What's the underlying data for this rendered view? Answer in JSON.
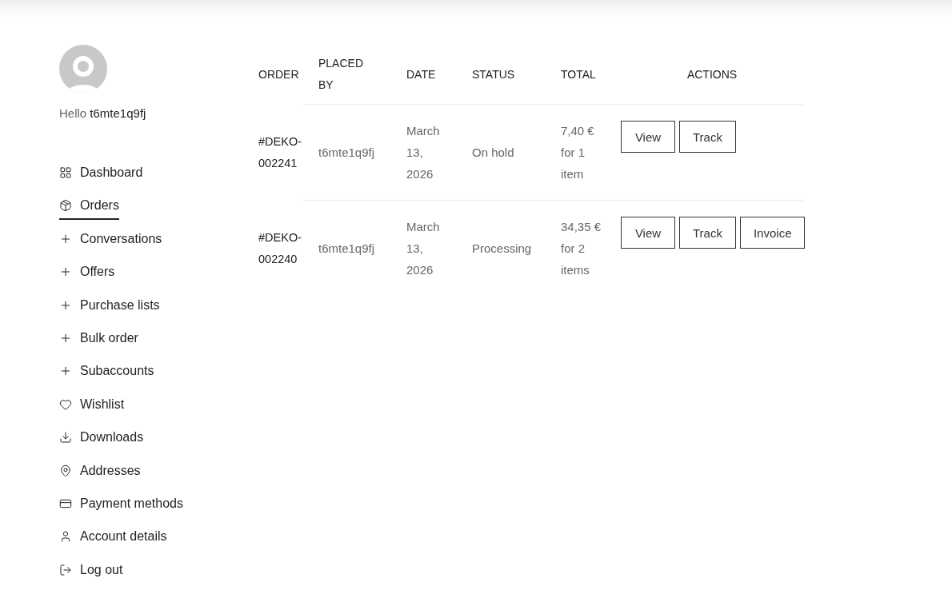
{
  "sidebar": {
    "greeting": "Hello",
    "username": "t6mte1q9fj",
    "items": [
      {
        "label": "Dashboard",
        "selected": false
      },
      {
        "label": "Orders",
        "selected": true
      },
      {
        "label": "Conversations",
        "selected": false
      },
      {
        "label": "Offers",
        "selected": false
      },
      {
        "label": "Purchase lists",
        "selected": false
      },
      {
        "label": "Bulk order",
        "selected": false
      },
      {
        "label": "Subaccounts",
        "selected": false
      },
      {
        "label": "Wishlist",
        "selected": false
      },
      {
        "label": "Downloads",
        "selected": false
      },
      {
        "label": "Addresses",
        "selected": false
      },
      {
        "label": "Payment methods",
        "selected": false
      },
      {
        "label": "Account details",
        "selected": false
      },
      {
        "label": "Log out",
        "selected": false
      }
    ]
  },
  "orders_table": {
    "columns": [
      "ORDER",
      "PLACED BY",
      "DATE",
      "STATUS",
      "TOTAL",
      "ACTIONS"
    ],
    "rows": [
      {
        "order": "#DEKO-002241",
        "placed_by": "t6mte1q9fj",
        "date": "March 13, 2026",
        "status": "On hold",
        "total": "7,40 € for 1 item",
        "actions": [
          "View",
          "Track"
        ]
      },
      {
        "order": "#DEKO-002240",
        "placed_by": "t6mte1q9fj",
        "date": "March 13, 2026",
        "status": "Processing",
        "total": "34,35 € for 2 items",
        "actions": [
          "View",
          "Track",
          "Invoice"
        ]
      }
    ]
  }
}
